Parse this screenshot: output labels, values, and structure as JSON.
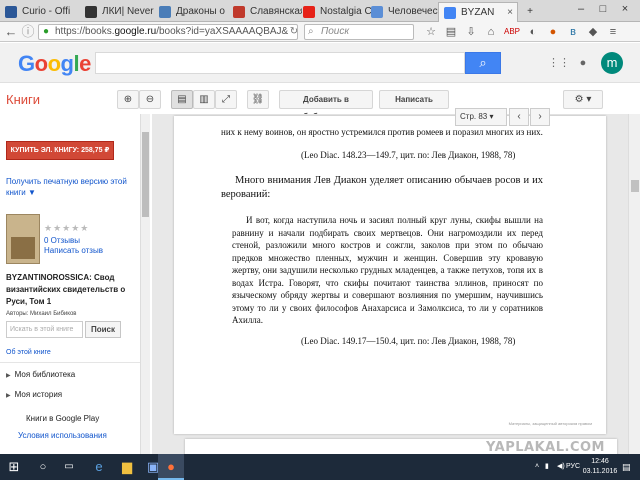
{
  "browser": {
    "tabs": [
      {
        "label": "Curio - Offi",
        "favicon_color": "#2b5797"
      },
      {
        "label": "ЛКИ| Never",
        "favicon_color": "#333333"
      },
      {
        "label": "Драконы о",
        "favicon_color": "#4a7db8"
      },
      {
        "label": "Славянская",
        "favicon_color": "#c0392b"
      },
      {
        "label": "Nostalgia Cr",
        "favicon_color": "#e62117"
      },
      {
        "label": "Человеческ",
        "favicon_color": "#5b8ed6"
      },
      {
        "label": "BYZAN",
        "favicon_color": "#4285f4"
      }
    ],
    "url_prefix": "https://books.",
    "url_host": "google.ru",
    "url_suffix": "/books?id=yaXSAAAAQBAJ&",
    "search_placeholder": "Поиск"
  },
  "google": {
    "logo": "Google",
    "avatar_letter": "m",
    "brand_colors": [
      "#4285f4",
      "#ea4335",
      "#fbbc05",
      "#4285f4",
      "#34a853",
      "#ea4335"
    ]
  },
  "books_toolbar": {
    "section_title": "Книги",
    "add_to_library": "Добавить в библиотеку",
    "write_review": "Написать отзыв",
    "page_selector": "Стр. 83"
  },
  "left_panel": {
    "buy_button": "КУПИТЬ ЭЛ. КНИГУ: 258,75 ₽",
    "print_version": "Получить печатную версию этой книги ▼",
    "reviews_count": "0 Отзывы",
    "write_review_link": "Написать отзыв",
    "book_title": "BYZANTINOROSSICA: Свод византийских свидетельств о Руси, Том 1",
    "author": "Авторы: Михаил Бибиков",
    "search_placeholder": "Искать в этой книге",
    "search_button": "Поиск",
    "about_book": "Об этой книге",
    "nav_items": [
      "Моя библиотека",
      "Моя история",
      "Книги в Google Play"
    ],
    "terms": "Условия использования"
  },
  "page": {
    "top_paragraph": "них к нему воинов, он яростно устремился против ромеев и поразил многих из них.",
    "citation_1": "(Leo Diac. 148.23—149.7, цит. по: Лев Диакон, 1988, 78)",
    "heading_paragraph": "Много внимания Лев Диакон уделяет описанию обычаев росов и их верований:",
    "quote": "И вот, когда наступила ночь и засиял полный круг луны, скифы вышли на равнину и начали подбирать своих мертвецов. Они нагромоздили их перед стеной, разложили много костров и сожгли, заколов при этом по обычаю предков множество пленных, мужчин и женщин. Совершив эту кровавую жертву, они задушили несколько грудных младенцев, а также петухов, топя их в водах Истра. Говорят, что скифы почитают таинства эллинов, приносят по языческому обряду жертвы и совершают возлияния по умершим, научившись этому то ли у своих философов Анахарсиса и Замолксиса, то ли у соратников Ахилла.",
    "citation_2": "(Leo Diac. 149.17—150.4, цит. по: Лев Диакон, 1988, 78)",
    "copyright": "Материалы, защищенный авторским правом"
  },
  "watermark": "YAPLAKAL.COM",
  "taskbar": {
    "language": "РУС",
    "time": "12:46",
    "date": "03.11.2016"
  }
}
